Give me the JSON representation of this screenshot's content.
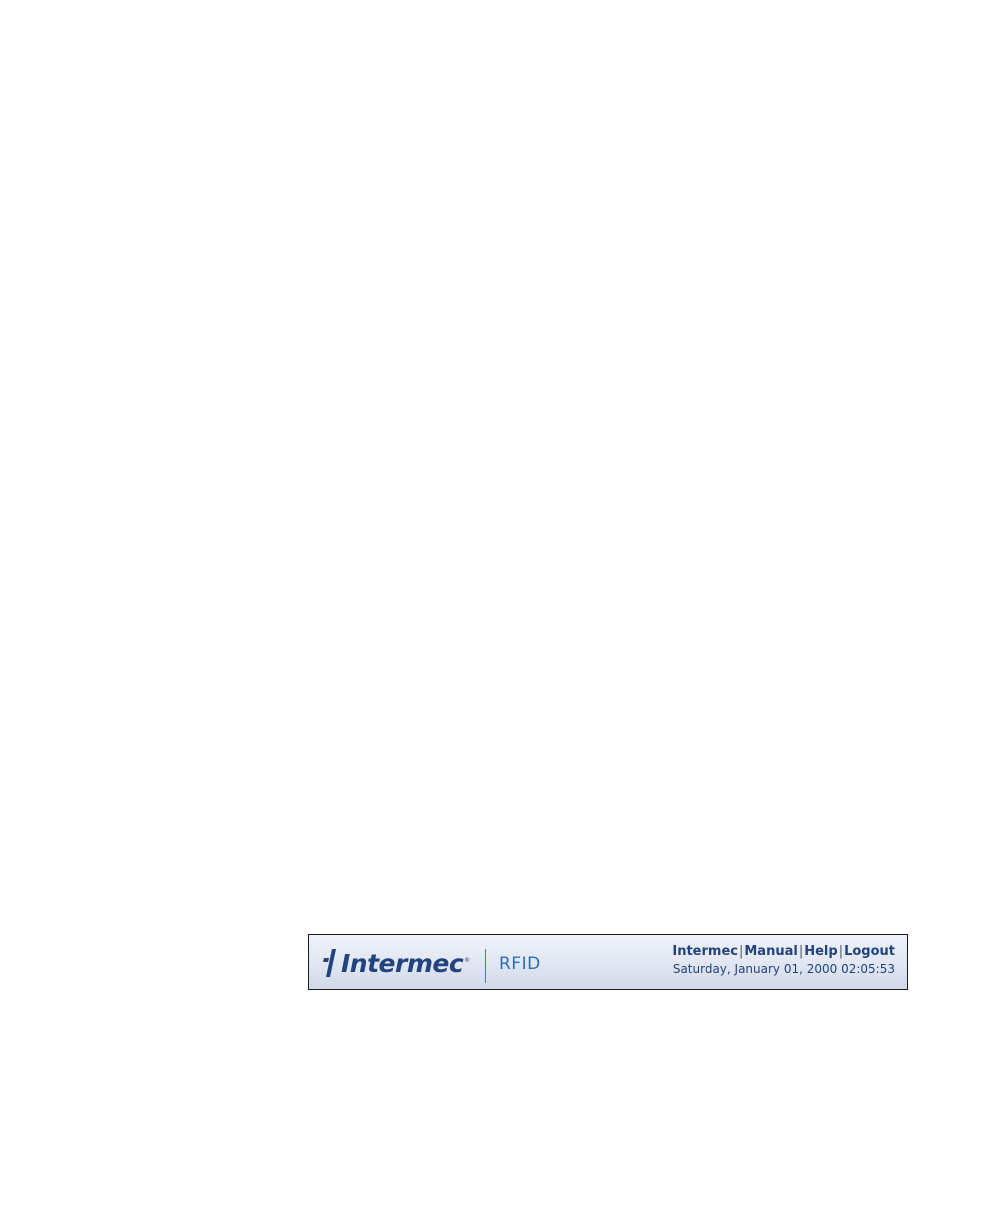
{
  "header": {
    "logo_text": "Intermec",
    "logo_reg_mark": "®",
    "product_name": "RFID",
    "links": [
      {
        "label": "Intermec"
      },
      {
        "label": "Manual"
      },
      {
        "label": "Help"
      },
      {
        "label": "Logout"
      }
    ],
    "link_separator": "|",
    "datetime": "Saturday, January 01, 2000 02:05:53"
  },
  "colors": {
    "brand_blue": "#22437e",
    "product_blue": "#2d6fb7",
    "bar_gradient_top": "#eef1f8",
    "bar_gradient_bottom": "#d2d9ea"
  }
}
